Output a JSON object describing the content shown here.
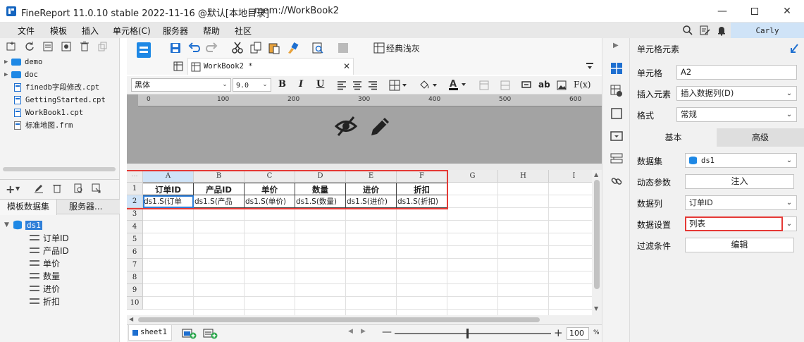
{
  "window": {
    "title": "FineReport 11.0.10 stable 2022-11-16 @默认[本地目录]",
    "path": "mem://WorkBook2"
  },
  "menu": [
    "文件",
    "模板",
    "插入",
    "单元格(C)",
    "服务器",
    "帮助",
    "社区"
  ],
  "user": "Carly",
  "file_tree": [
    {
      "name": "demo",
      "type": "folder"
    },
    {
      "name": "doc",
      "type": "folder"
    },
    {
      "name": "finedb字段修改.cpt",
      "type": "file"
    },
    {
      "name": "GettingStarted.cpt",
      "type": "file"
    },
    {
      "name": "WorkBook1.cpt",
      "type": "file"
    },
    {
      "name": "标准地图.frm",
      "type": "file"
    }
  ],
  "dataset_tabs": [
    "模板数据集",
    "服务器..."
  ],
  "dataset": {
    "name": "ds1",
    "fields": [
      "订单ID",
      "产品ID",
      "单价",
      "数量",
      "进价",
      "折扣"
    ]
  },
  "toolbar": {
    "theme_label": "经典浅灰",
    "doc_tab": "WorkBook2 *"
  },
  "format": {
    "font": "黑体",
    "size": "9.0",
    "bold": "B",
    "italic": "I",
    "underline": "U",
    "label_ab": "ab",
    "fx": "F(x)"
  },
  "ruler_ticks": [
    "0",
    "100",
    "200",
    "300",
    "400",
    "500",
    "600"
  ],
  "grid": {
    "columns": [
      "A",
      "B",
      "C",
      "D",
      "E",
      "F",
      "G",
      "H",
      "I"
    ],
    "rows": [
      "1",
      "2",
      "3",
      "4",
      "5",
      "6",
      "7",
      "8",
      "9",
      "10"
    ],
    "row1": [
      "订单ID",
      "产品ID",
      "单价",
      "数量",
      "进价",
      "折扣"
    ],
    "row2": [
      "ds1.S(订单",
      "ds1.S(产品",
      "ds1.S(单价)",
      "ds1.S(数量)",
      "ds1.S(进价)",
      "ds1.S(折扣)"
    ]
  },
  "sheet_tab": "sheet1",
  "zoom": "100",
  "zoom_unit": "%",
  "right_panel": {
    "title": "单元格元素",
    "cell_label": "单元格",
    "cell_value": "A2",
    "insert_label": "插入元素",
    "insert_value": "插入数据列(D)",
    "format_label": "格式",
    "format_value": "常规",
    "tab_basic": "基本",
    "tab_advanced": "高级",
    "dataset_label": "数据集",
    "dataset_value": "ds1",
    "dyn_param_label": "动态参数",
    "inject_button": "注入",
    "column_label": "数据列",
    "column_value": "订单ID",
    "setting_label": "数据设置",
    "setting_value": "列表",
    "filter_label": "过滤条件",
    "edit_button": "编辑"
  }
}
